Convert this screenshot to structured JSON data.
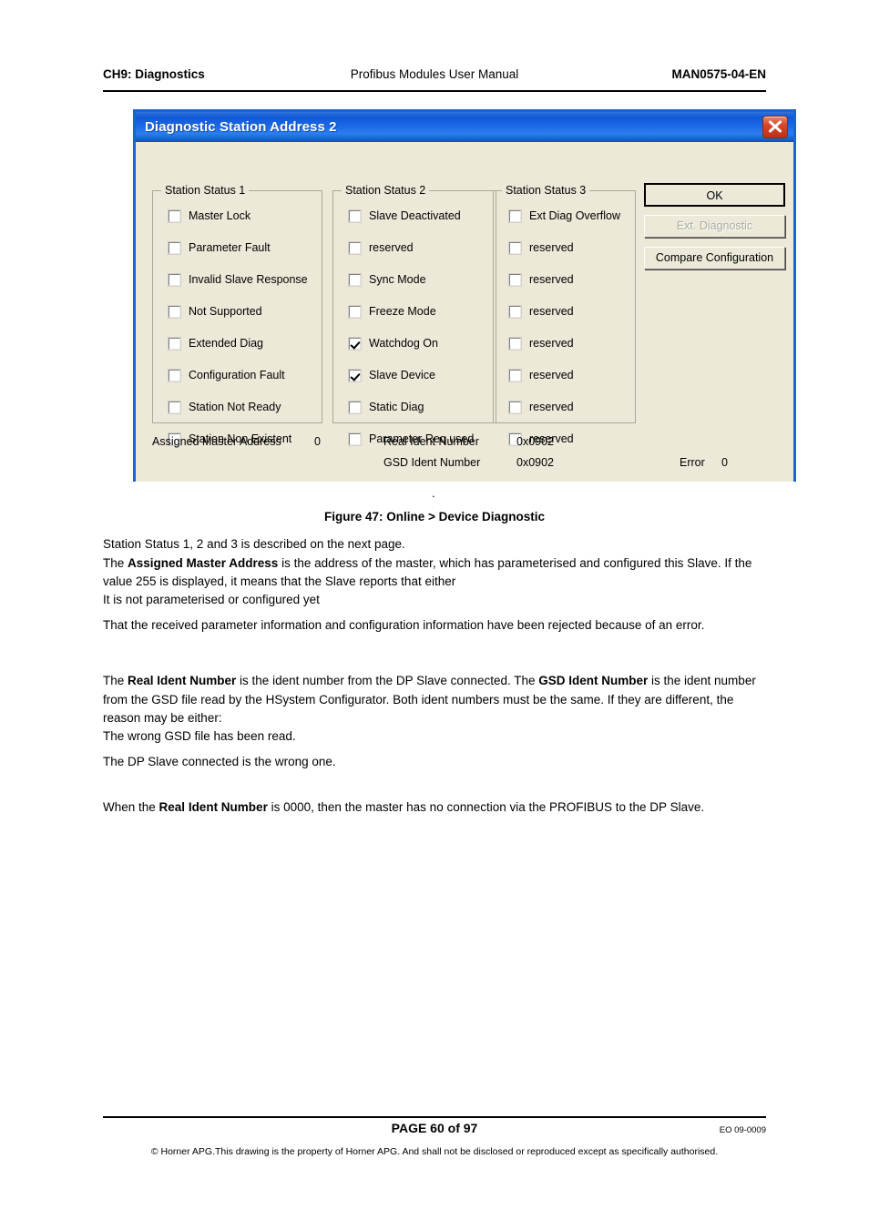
{
  "header": {
    "left": "CH9: Diagnostics",
    "center": "Profibus Modules User Manual",
    "right": "MAN0575-04-EN"
  },
  "dialog": {
    "title": "Diagnostic Station Address 2",
    "close_icon": "close-icon",
    "groups": [
      {
        "legend": "Station Status 1",
        "items": [
          {
            "label": "Master Lock",
            "checked": false
          },
          {
            "label": "Parameter Fault",
            "checked": false
          },
          {
            "label": "Invalid Slave Response",
            "checked": false
          },
          {
            "label": "Not Supported",
            "checked": false
          },
          {
            "label": "Extended Diag",
            "checked": false
          },
          {
            "label": "Configuration Fault",
            "checked": false
          },
          {
            "label": "Station Not Ready",
            "checked": false
          },
          {
            "label": "Station Non Existent",
            "checked": false
          }
        ]
      },
      {
        "legend": "Station Status 2",
        "items": [
          {
            "label": "Slave Deactivated",
            "checked": false
          },
          {
            "label": "reserved",
            "checked": false
          },
          {
            "label": "Sync Mode",
            "checked": false
          },
          {
            "label": "Freeze Mode",
            "checked": false
          },
          {
            "label": "Watchdog On",
            "checked": true
          },
          {
            "label": "Slave Device",
            "checked": true
          },
          {
            "label": "Static Diag",
            "checked": false
          },
          {
            "label": "Parameter Req used",
            "checked": false
          }
        ]
      },
      {
        "legend": "Station Status 3",
        "items": [
          {
            "label": "Ext Diag Overflow",
            "checked": false
          },
          {
            "label": "reserved",
            "checked": false
          },
          {
            "label": "reserved",
            "checked": false
          },
          {
            "label": "reserved",
            "checked": false
          },
          {
            "label": "reserved",
            "checked": false
          },
          {
            "label": "reserved",
            "checked": false
          },
          {
            "label": "reserved",
            "checked": false
          },
          {
            "label": "reserved",
            "checked": false
          }
        ]
      }
    ],
    "buttons": {
      "ok": "OK",
      "ext_diagnostic": "Ext. Diagnostic",
      "compare_configuration": "Compare Configuration"
    },
    "info": {
      "assigned_master_address_label": "Assigned Master Address",
      "assigned_master_address_value": "0",
      "real_ident_number_label": "Real Ident Number",
      "real_ident_number_value": "0x0902",
      "gsd_ident_number_label": "GSD Ident Number",
      "gsd_ident_number_value": "0x0902",
      "error_label": "Error",
      "error_value": "0"
    },
    "stray_dot": "."
  },
  "figure": {
    "caption": "Figure 47: Online > Device Diagnostic"
  },
  "body": {
    "p1_line1": "Station Status 1, 2 and 3 is described on the next page.",
    "p1_line2_a": "The ",
    "p1_line2_b": "Assigned Master Address",
    "p1_line2_c": " is the address of the master, which has parameterised and configured this Slave.  If the value 255 is displayed, it means that the Slave reports that either",
    "p2": "It is not parameterised or configured yet",
    "p3": "That the received parameter information and configuration information have been rejected because of an error.",
    "p4_a": "The ",
    "p4_b": "Real Ident Number",
    "p4_c": " is the ident number from the DP Slave connected.  The ",
    "p4_d": "GSD Ident Number",
    "p4_e": " is the ident number from the GSD file read by the HSystem Configurator.  Both ident numbers must be the same.  If they are different, the reason may be either:",
    "p5": "The wrong GSD file has been read.",
    "p6": "The DP Slave connected is the wrong one.",
    "p7_a": "When the ",
    "p7_b": "Real Ident Number",
    "p7_c": " is 0000, then the master has no connection via the PROFIBUS to the DP Slave."
  },
  "footer": {
    "page": "PAGE 60 of 97",
    "eo": "EO 09-0009",
    "copyright": "© Horner APG.This drawing is the property of Horner APG. And shall not be disclosed or reproduced except as specifically authorised."
  }
}
